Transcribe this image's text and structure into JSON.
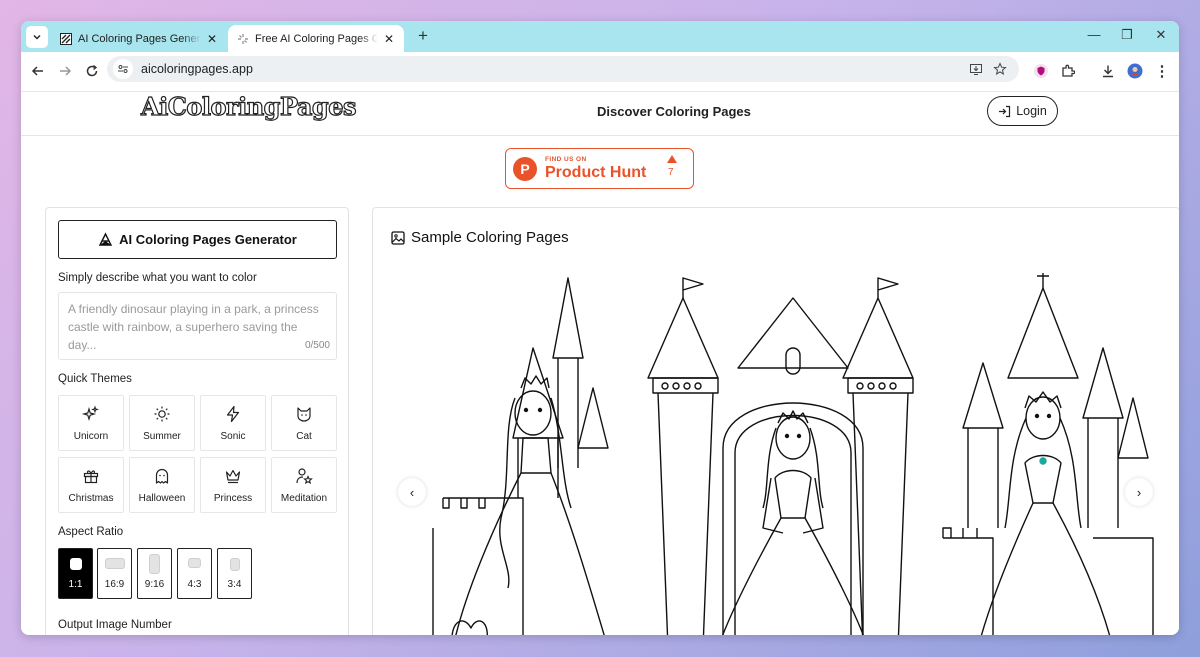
{
  "browser": {
    "tabs": [
      {
        "title": "AI Coloring Pages Generator | Free",
        "active": false
      },
      {
        "title": "Free AI Coloring Pages Generator",
        "active": true
      }
    ],
    "url": "aicoloringpages.app",
    "new_tab_label": "+",
    "close_glyph": "✕"
  },
  "site": {
    "logo_text": "AiColoringPages",
    "nav_discover": "Discover Coloring Pages",
    "login_label": "Login",
    "product_hunt": {
      "find_us": "FIND US ON",
      "name": "Product Hunt",
      "letter": "P",
      "upvotes": "7"
    }
  },
  "generator": {
    "button_label": "AI Coloring Pages Generator",
    "describe_label": "Simply describe what you want to color",
    "prompt_placeholder": "A friendly dinosaur playing in a park, a princess castle with rainbow, a superhero saving the day...",
    "char_count": "0/500",
    "quick_themes_label": "Quick Themes",
    "themes": [
      {
        "label": "Unicorn",
        "icon": "sparkles-icon"
      },
      {
        "label": "Summer",
        "icon": "sun-icon"
      },
      {
        "label": "Sonic",
        "icon": "lightning-icon"
      },
      {
        "label": "Cat",
        "icon": "cat-icon"
      },
      {
        "label": "Christmas",
        "icon": "gift-icon"
      },
      {
        "label": "Halloween",
        "icon": "ghost-icon"
      },
      {
        "label": "Princess",
        "icon": "crown-icon"
      },
      {
        "label": "Meditation",
        "icon": "person-star-icon"
      }
    ],
    "aspect_ratio_label": "Aspect Ratio",
    "ratios": [
      {
        "label": "1:1",
        "active": true
      },
      {
        "label": "16:9",
        "active": false
      },
      {
        "label": "9:16",
        "active": false
      },
      {
        "label": "4:3",
        "active": false
      },
      {
        "label": "3:4",
        "active": false
      }
    ],
    "output_number_label": "Output Image Number"
  },
  "samples": {
    "title": "Sample Coloring Pages",
    "prev": "‹",
    "next": "›"
  },
  "colors": {
    "accent": "#ea532a",
    "tabstrip": "#a9e5ef"
  }
}
